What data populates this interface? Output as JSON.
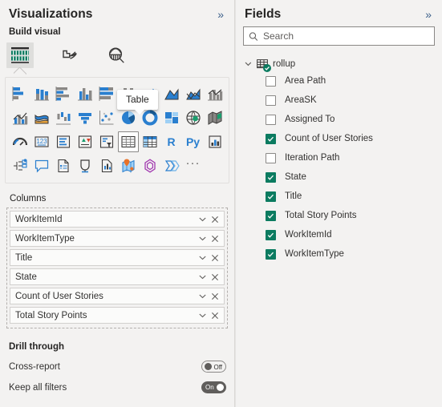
{
  "visualizations": {
    "title": "Visualizations",
    "collapse_icon": "chevron-double-right-icon",
    "build_visual_label": "Build visual",
    "mode_tabs": [
      {
        "name": "build-visual",
        "icon": "table-fields-icon",
        "selected": true
      },
      {
        "name": "format-visual",
        "icon": "paintbrush-icon",
        "selected": false
      },
      {
        "name": "analytics",
        "icon": "magnifier-chart-icon",
        "selected": false
      }
    ],
    "tooltip": {
      "text": "Table"
    },
    "gallery": [
      {
        "name": "stacked-bar-chart-icon",
        "selected": false
      },
      {
        "name": "stacked-column-chart-icon",
        "selected": false
      },
      {
        "name": "clustered-bar-chart-icon",
        "selected": false
      },
      {
        "name": "clustered-column-chart-icon",
        "selected": false
      },
      {
        "name": "100-stacked-bar-chart-icon",
        "selected": false
      },
      {
        "name": "100-stacked-column-chart-icon",
        "selected": false
      },
      {
        "name": "line-chart-icon",
        "selected": false
      },
      {
        "name": "area-chart-icon",
        "selected": false
      },
      {
        "name": "stacked-area-chart-icon",
        "selected": false
      },
      {
        "name": "line-stacked-column-chart-icon",
        "selected": false
      },
      {
        "name": "line-clustered-column-chart-icon",
        "selected": false
      },
      {
        "name": "ribbon-chart-icon",
        "selected": false
      },
      {
        "name": "waterfall-chart-icon",
        "selected": false
      },
      {
        "name": "funnel-chart-icon",
        "selected": false
      },
      {
        "name": "scatter-chart-icon",
        "selected": false
      },
      {
        "name": "pie-chart-icon",
        "selected": false
      },
      {
        "name": "donut-chart-icon",
        "selected": false
      },
      {
        "name": "treemap-icon",
        "selected": false
      },
      {
        "name": "map-icon",
        "selected": false
      },
      {
        "name": "filled-map-icon",
        "selected": false
      },
      {
        "name": "gauge-icon",
        "selected": false
      },
      {
        "name": "card-icon",
        "selected": false
      },
      {
        "name": "multi-row-card-icon",
        "selected": false
      },
      {
        "name": "kpi-icon",
        "selected": false
      },
      {
        "name": "slicer-icon",
        "selected": false
      },
      {
        "name": "table-icon",
        "selected": true
      },
      {
        "name": "matrix-icon",
        "selected": false
      },
      {
        "name": "r-script-visual-icon",
        "selected": false,
        "text": "R"
      },
      {
        "name": "python-visual-icon",
        "selected": false,
        "text": "Py"
      },
      {
        "name": "key-influencers-icon",
        "selected": false
      },
      {
        "name": "decomposition-tree-icon",
        "selected": false
      },
      {
        "name": "smart-narrative-icon",
        "selected": false
      },
      {
        "name": "paginated-report-icon",
        "selected": false
      },
      {
        "name": "qna-icon",
        "selected": false
      },
      {
        "name": "metrics-icon",
        "selected": false
      },
      {
        "name": "arcgis-map-icon",
        "selected": false
      },
      {
        "name": "azure-map-icon",
        "selected": false
      },
      {
        "name": "power-automate-icon",
        "selected": false
      },
      {
        "name": "more-options-icon",
        "selected": false,
        "text": "···"
      }
    ],
    "wells": {
      "columns_label": "Columns",
      "columns": [
        {
          "label": "WorkItemId"
        },
        {
          "label": "WorkItemType"
        },
        {
          "label": "Title"
        },
        {
          "label": "State"
        },
        {
          "label": "Count of User Stories"
        },
        {
          "label": "Total Story Points"
        }
      ]
    },
    "drill_through": {
      "heading": "Drill through",
      "rows": [
        {
          "label": "Cross-report",
          "state": "Off",
          "on": false
        },
        {
          "label": "Keep all filters",
          "state": "On",
          "on": true
        }
      ]
    }
  },
  "fields": {
    "title": "Fields",
    "collapse_icon": "chevron-double-right-icon",
    "search": {
      "placeholder": "Search",
      "value": "",
      "icon": "search-icon"
    },
    "table_node": {
      "label": "rollup",
      "expanded": true,
      "icon": "table-icon",
      "badge": "check-badge-icon"
    },
    "items": [
      {
        "label": "Area Path",
        "checked": false
      },
      {
        "label": "AreaSK",
        "checked": false
      },
      {
        "label": "Assigned To",
        "checked": false
      },
      {
        "label": "Count of User Stories",
        "checked": true
      },
      {
        "label": "Iteration Path",
        "checked": false
      },
      {
        "label": "State",
        "checked": true
      },
      {
        "label": "Title",
        "checked": true
      },
      {
        "label": "Total Story Points",
        "checked": true
      },
      {
        "label": "WorkItemId",
        "checked": true
      },
      {
        "label": "WorkItemType",
        "checked": true
      }
    ]
  },
  "colors": {
    "accent_teal": "#0b7b60",
    "chart_blue": "#2a7fcf",
    "chart_gray": "#8a8886",
    "panel_bg": "#f3f2f1",
    "text": "#323130"
  }
}
